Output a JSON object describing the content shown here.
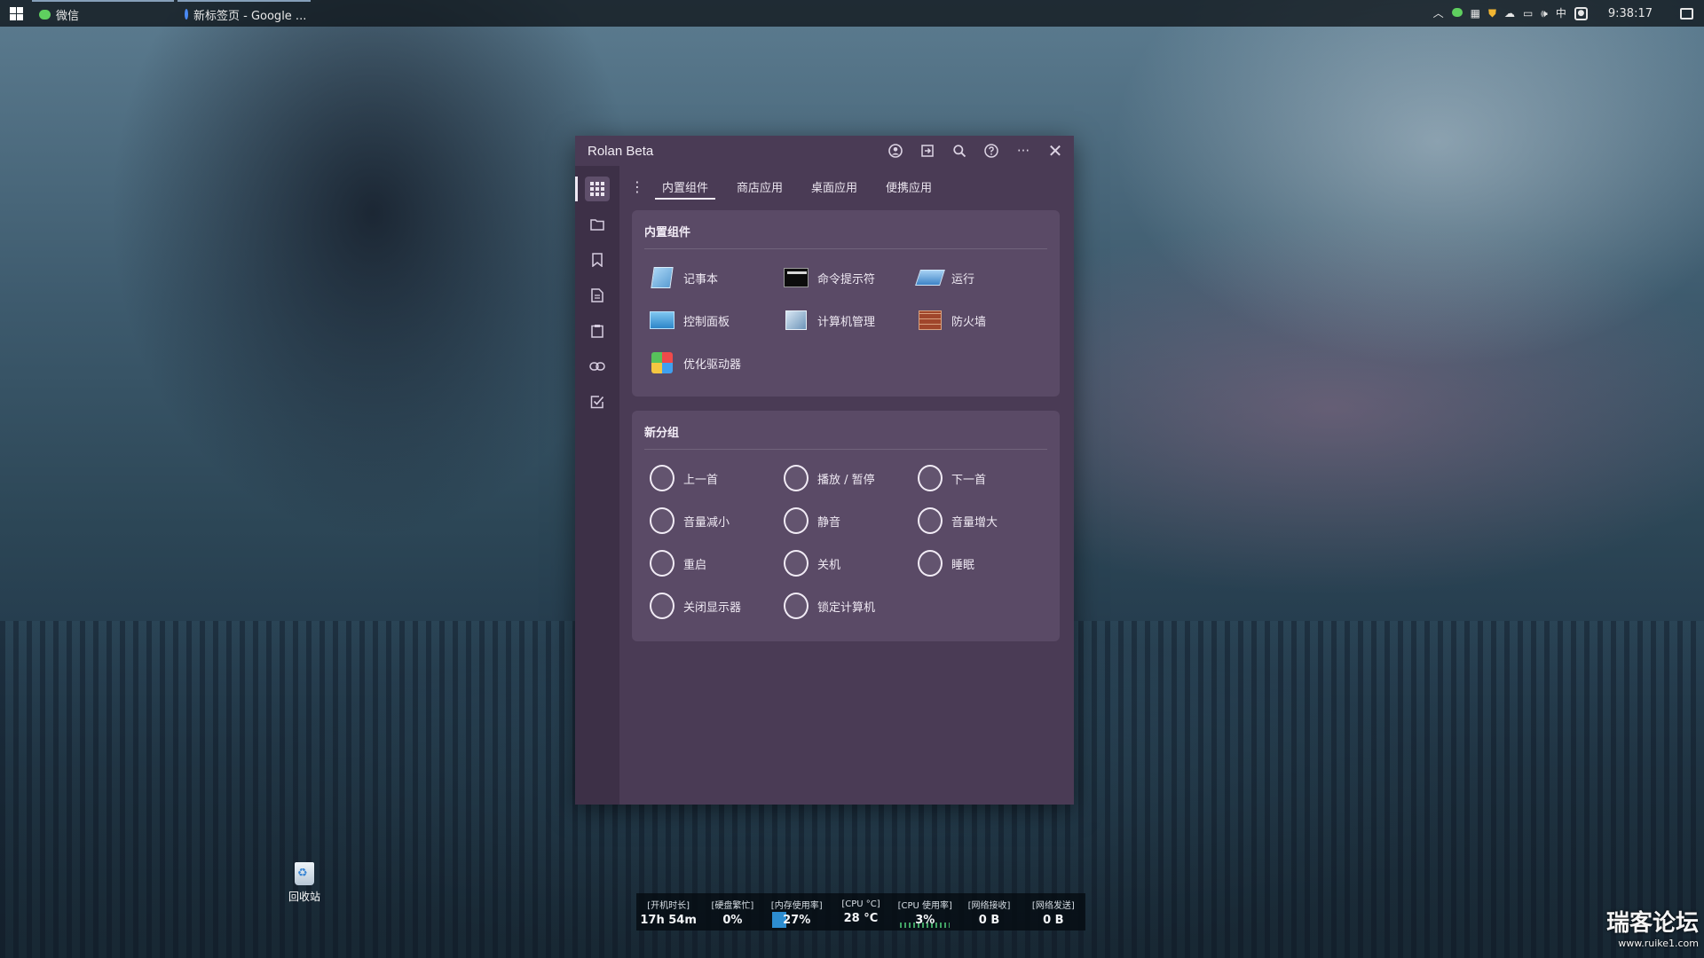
{
  "taskbar": {
    "items": [
      {
        "label": "微信"
      },
      {
        "label": "新标签页 - Google ..."
      }
    ],
    "tray": {
      "ime": "中",
      "clock": "9:38:17"
    }
  },
  "window": {
    "title": "Rolan Beta",
    "tabs": [
      "内置组件",
      "商店应用",
      "桌面应用",
      "便携应用"
    ],
    "groups": [
      {
        "title": "内置组件",
        "items": [
          "记事本",
          "命令提示符",
          "运行",
          "控制面板",
          "计算机管理",
          "防火墙",
          "优化驱动器"
        ]
      },
      {
        "title": "新分组",
        "items": [
          "上一首",
          "播放 / 暂停",
          "下一首",
          "音量减小",
          "静音",
          "音量增大",
          "重启",
          "关机",
          "睡眠",
          "关闭显示器",
          "锁定计算机"
        ]
      }
    ]
  },
  "desktop": {
    "recycle_bin": "回收站"
  },
  "monitor": {
    "uptime_label": "[开机时长]",
    "uptime": "17h 54m",
    "disk_label": "[硬盘繁忙]",
    "disk": "0%",
    "mem_label": "[内存使用率]",
    "mem": "27%",
    "cpu_temp_label": "[CPU °C]",
    "cpu_temp": "28 °C",
    "cpu_label": "[CPU 使用率]",
    "cpu": "3%",
    "net_in_label": "[网络接收]",
    "net_in": "0 B",
    "net_out_label": "[网络发送]",
    "net_out": "0 B"
  },
  "watermark": {
    "title": "瑞客论坛",
    "url": "www.ruike1.com"
  }
}
